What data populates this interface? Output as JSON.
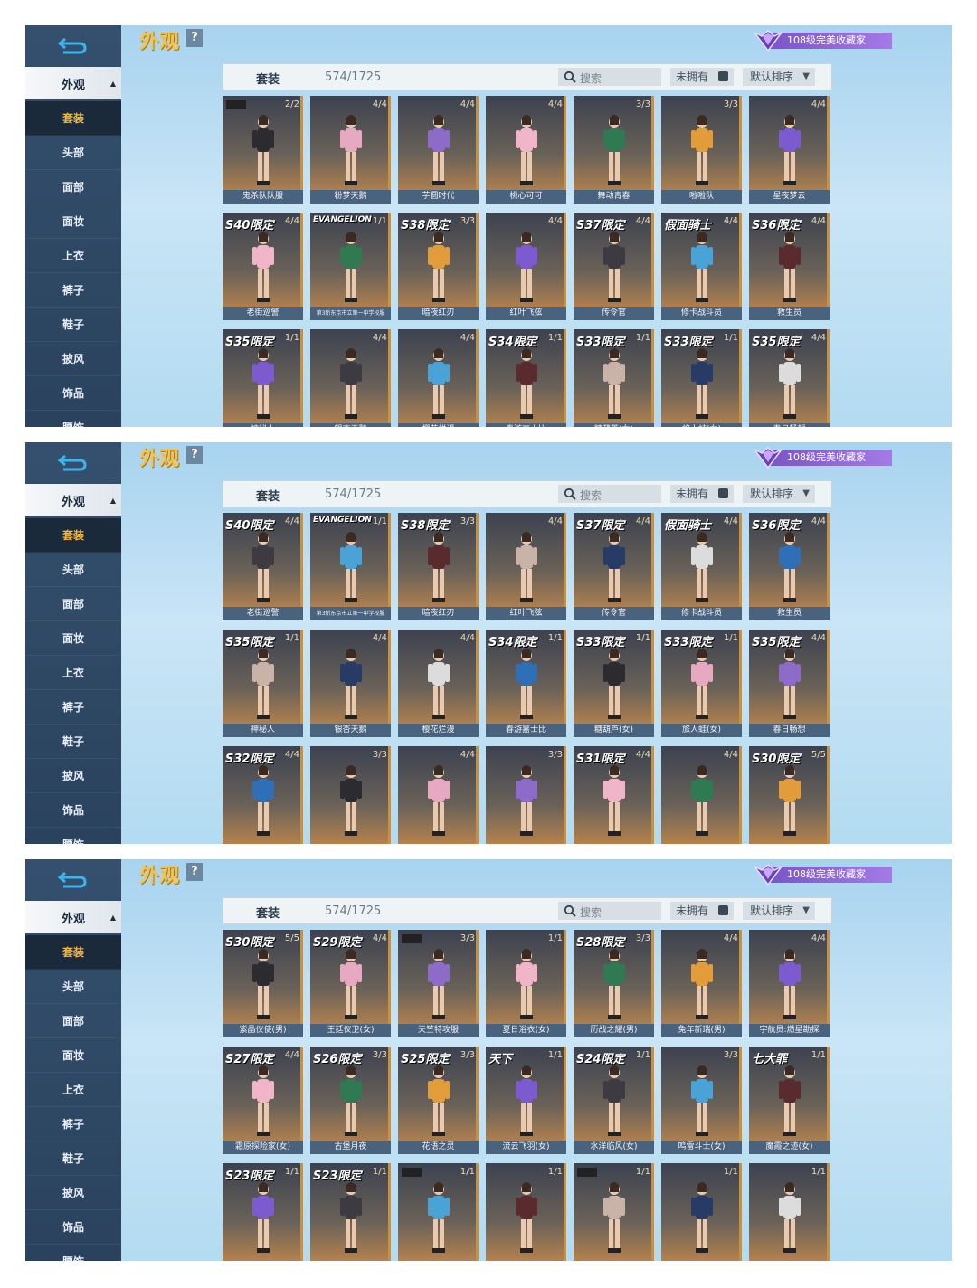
{
  "sidebar_main": "外观",
  "sidebar_items": [
    "套装",
    "头部",
    "面部",
    "面妆",
    "上衣",
    "裤子",
    "鞋子",
    "披风",
    "饰品",
    "腰饰"
  ],
  "title": "外观",
  "help": "?",
  "collector": "108级完美收藏家",
  "toolbar": {
    "label": "套装",
    "count": "574/1725",
    "search_placeholder": "搜索",
    "owned_label": "未拥有",
    "sort_label": "默认排序"
  },
  "panels": [
    {
      "rows": [
        [
          {
            "tag": "",
            "cnt": "2/2",
            "name": "鬼杀队队服",
            "badge": true
          },
          {
            "tag": "",
            "cnt": "4/4",
            "name": "粉梦天鹅"
          },
          {
            "tag": "",
            "cnt": "4/4",
            "name": "芋圆时代"
          },
          {
            "tag": "",
            "cnt": "4/4",
            "name": "桃心可可"
          },
          {
            "tag": "",
            "cnt": "3/3",
            "name": "舞动青春"
          },
          {
            "tag": "",
            "cnt": "3/3",
            "name": "啦啦队"
          },
          {
            "tag": "",
            "cnt": "4/4",
            "name": "星夜梦云"
          }
        ],
        [
          {
            "tag": "S40限定",
            "cnt": "4/4",
            "name": "老街巡警"
          },
          {
            "tag": "EVANGELION",
            "cnt": "1/1",
            "name": "第3新东京市立第一中学校服"
          },
          {
            "tag": "S38限定",
            "cnt": "3/3",
            "name": "暗夜红刃"
          },
          {
            "tag": "",
            "cnt": "4/4",
            "name": "红叶飞弦"
          },
          {
            "tag": "S37限定",
            "cnt": "4/4",
            "name": "传令官"
          },
          {
            "tag": "假面骑士",
            "cnt": "4/4",
            "name": "修卡战斗员"
          },
          {
            "tag": "S36限定",
            "cnt": "4/4",
            "name": "救生员"
          }
        ],
        [
          {
            "tag": "S35限定",
            "cnt": "1/1",
            "name": "神秘人"
          },
          {
            "tag": "",
            "cnt": "4/4",
            "name": "银杏天鹅"
          },
          {
            "tag": "",
            "cnt": "4/4",
            "name": "樱花烂漫"
          },
          {
            "tag": "S34限定",
            "cnt": "1/1",
            "name": "春游嘉士比"
          },
          {
            "tag": "S33限定",
            "cnt": "1/1",
            "name": "糖葫芦(女)"
          },
          {
            "tag": "S33限定",
            "cnt": "1/1",
            "name": "旅人蛙(女)"
          },
          {
            "tag": "S35限定",
            "cnt": "4/4",
            "name": "春日畅想"
          }
        ]
      ]
    },
    {
      "rows": [
        [
          {
            "tag": "S40限定",
            "cnt": "4/4",
            "name": "老街巡警"
          },
          {
            "tag": "EVANGELION",
            "cnt": "1/1",
            "name": "第3新东京市立第一中学校服"
          },
          {
            "tag": "S38限定",
            "cnt": "3/3",
            "name": "暗夜红刃"
          },
          {
            "tag": "",
            "cnt": "4/4",
            "name": "红叶飞弦"
          },
          {
            "tag": "S37限定",
            "cnt": "4/4",
            "name": "传令官"
          },
          {
            "tag": "假面骑士",
            "cnt": "4/4",
            "name": "修卡战斗员"
          },
          {
            "tag": "S36限定",
            "cnt": "4/4",
            "name": "救生员"
          }
        ],
        [
          {
            "tag": "S35限定",
            "cnt": "1/1",
            "name": "神秘人"
          },
          {
            "tag": "",
            "cnt": "4/4",
            "name": "银杏天鹅"
          },
          {
            "tag": "",
            "cnt": "4/4",
            "name": "樱花烂漫"
          },
          {
            "tag": "S34限定",
            "cnt": "1/1",
            "name": "春游嘉士比"
          },
          {
            "tag": "S33限定",
            "cnt": "1/1",
            "name": "糖葫芦(女)"
          },
          {
            "tag": "S33限定",
            "cnt": "1/1",
            "name": "旅人蛙(女)"
          },
          {
            "tag": "S35限定",
            "cnt": "4/4",
            "name": "春日畅想"
          }
        ],
        [
          {
            "tag": "S32限定",
            "cnt": "4/4",
            "name": ""
          },
          {
            "tag": "",
            "cnt": "3/3",
            "name": ""
          },
          {
            "tag": "",
            "cnt": "4/4",
            "name": ""
          },
          {
            "tag": "",
            "cnt": "3/3",
            "name": ""
          },
          {
            "tag": "S31限定",
            "cnt": "4/4",
            "name": ""
          },
          {
            "tag": "",
            "cnt": "4/4",
            "name": ""
          },
          {
            "tag": "S30限定",
            "cnt": "5/5",
            "name": ""
          }
        ]
      ]
    },
    {
      "rows": [
        [
          {
            "tag": "S30限定",
            "cnt": "5/5",
            "name": "紫晶仪使(男)"
          },
          {
            "tag": "S29限定",
            "cnt": "4/4",
            "name": "王廷仪卫(女)"
          },
          {
            "tag": "",
            "cnt": "3/3",
            "name": "天竺特攻服",
            "badge": true
          },
          {
            "tag": "",
            "cnt": "1/1",
            "name": "夏日浴衣(女)"
          },
          {
            "tag": "S28限定",
            "cnt": "3/3",
            "name": "历战之耀(男)"
          },
          {
            "tag": "",
            "cnt": "4/4",
            "name": "兔年新瑞(男)"
          },
          {
            "tag": "",
            "cnt": "4/4",
            "name": "宇航员:燃星勘探"
          }
        ],
        [
          {
            "tag": "S27限定",
            "cnt": "4/4",
            "name": "霜原探险家(女)"
          },
          {
            "tag": "S26限定",
            "cnt": "3/3",
            "name": "古堡月夜"
          },
          {
            "tag": "S25限定",
            "cnt": "3/3",
            "name": "花语之灵"
          },
          {
            "tag": "天下",
            "cnt": "1/1",
            "name": "流云飞羽(女)"
          },
          {
            "tag": "S24限定",
            "cnt": "1/1",
            "name": "水洋临风(女)"
          },
          {
            "tag": "",
            "cnt": "3/3",
            "name": "鸣雷斗士(女)"
          },
          {
            "tag": "七大罪",
            "cnt": "1/1",
            "name": "魔霞之迹(女)"
          }
        ],
        [
          {
            "tag": "S23限定",
            "cnt": "1/1",
            "name": ""
          },
          {
            "tag": "S23限定",
            "cnt": "1/1",
            "name": ""
          },
          {
            "tag": "",
            "cnt": "1/1",
            "name": "",
            "badge": true
          },
          {
            "tag": "",
            "cnt": "1/1",
            "name": ""
          },
          {
            "tag": "",
            "cnt": "1/1",
            "name": "",
            "badge": true
          },
          {
            "tag": "",
            "cnt": "1/1",
            "name": ""
          },
          {
            "tag": "",
            "cnt": "1/1",
            "name": ""
          }
        ]
      ]
    }
  ]
}
